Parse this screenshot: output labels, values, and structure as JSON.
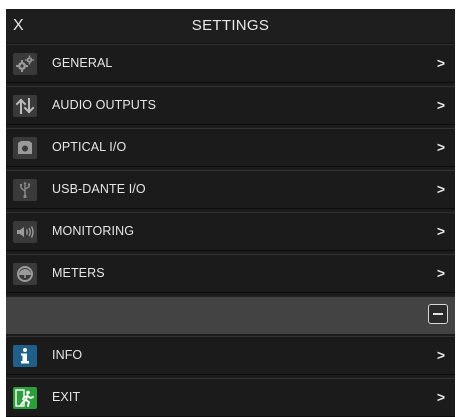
{
  "header": {
    "close_label": "X",
    "title": "SETTINGS"
  },
  "menu": {
    "items": [
      {
        "label": "GENERAL",
        "icon": "gears-icon",
        "arrow": ">"
      },
      {
        "label": "AUDIO OUTPUTS",
        "icon": "up-down-arrows-icon",
        "arrow": ">"
      },
      {
        "label": "OPTICAL I/O",
        "icon": "optical-port-icon",
        "arrow": ">"
      },
      {
        "label": "USB-DANTE I/O",
        "icon": "usb-icon",
        "arrow": ">"
      },
      {
        "label": "MONITORING",
        "icon": "speaker-icon",
        "arrow": ">"
      },
      {
        "label": "METERS",
        "icon": "meter-gauge-icon",
        "arrow": ">"
      }
    ],
    "bottom_items": [
      {
        "label": "INFO",
        "icon": "info-icon",
        "arrow": ">"
      },
      {
        "label": "EXIT",
        "icon": "exit-icon",
        "arrow": ">"
      }
    ]
  },
  "colors": {
    "background": "#1c1c1c",
    "row_border": "#333333",
    "text": "#e6e6e6",
    "collapse_bar": "#434343",
    "info_icon_bg": "#1f5f8a",
    "exit_icon_bg": "#2e9e3c"
  }
}
